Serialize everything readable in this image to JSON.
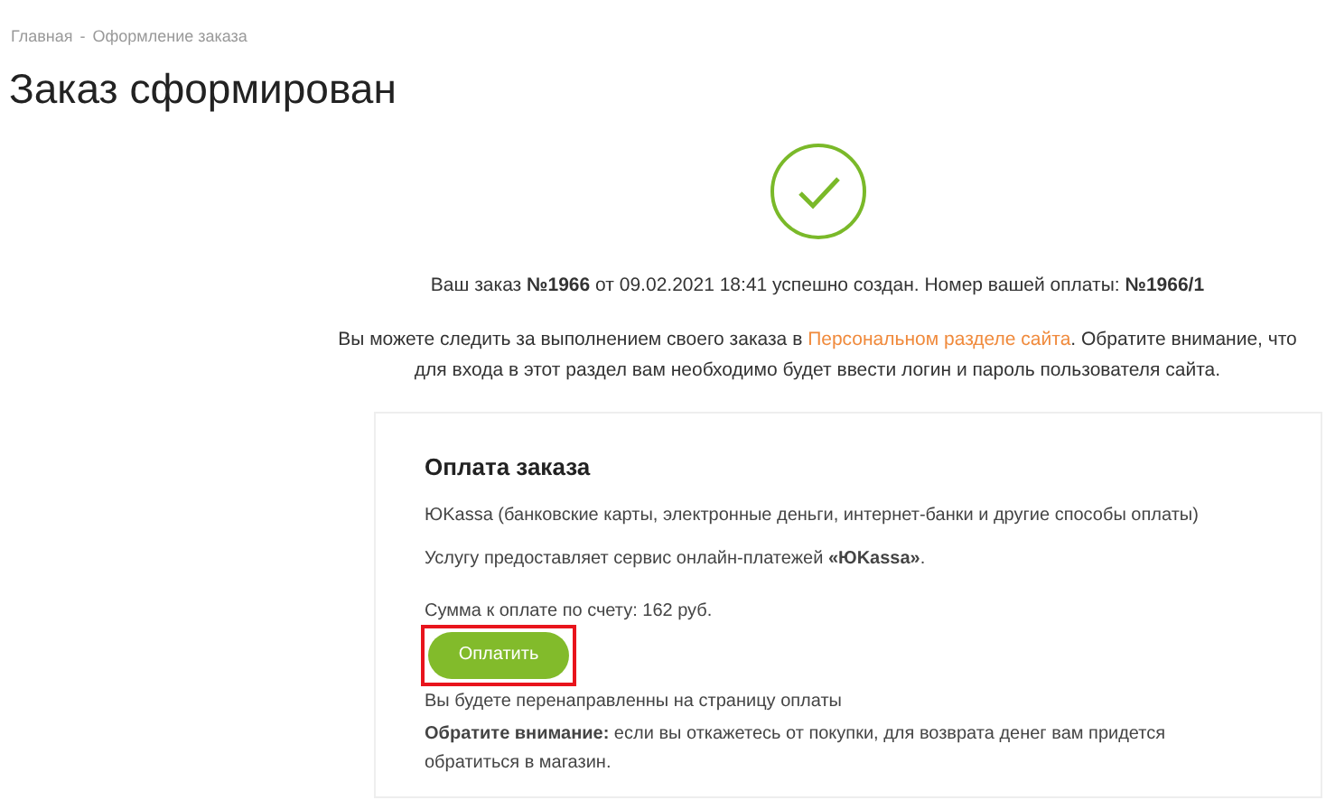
{
  "breadcrumbs": [
    {
      "label": "Главная"
    },
    {
      "label": "Оформление заказа"
    }
  ],
  "breadcrumb_separator": "-",
  "title": "Заказ сформирован",
  "order_message": "Ваш заказ **№1966** от 09.02.2021 18:41 успешно создан. Номер вашей оплаты: **№1966/1**",
  "tracking_message": {
    "before": "Вы можете следить за выполнением своего заказа в",
    "link": "Персональном разделе сайта",
    "after": ". Обратите внимание, что для входа в этот раздел вам необходимо будет ввести логин и пароль пользователя сайта."
  },
  "payment": {
    "title": "Оплата заказа",
    "method": "ЮKassa (банковские карты, электронные деньги, интернет-банки и другие способы оплаты)",
    "provider": "Услугу предоставляет сервис онлайн-платежей **«ЮKassa»**.",
    "amount": "Сумма к оплате по счету: 162 руб.",
    "button": {
      "label": "Оплатить",
      "highlighted": true
    },
    "redirect_note": "Вы будете перенаправленны на страницу оплаты",
    "warning": "**Обратите внимание:** если вы откажетесь от покупки, для возврата денег вам придется обратиться в магазин."
  }
}
